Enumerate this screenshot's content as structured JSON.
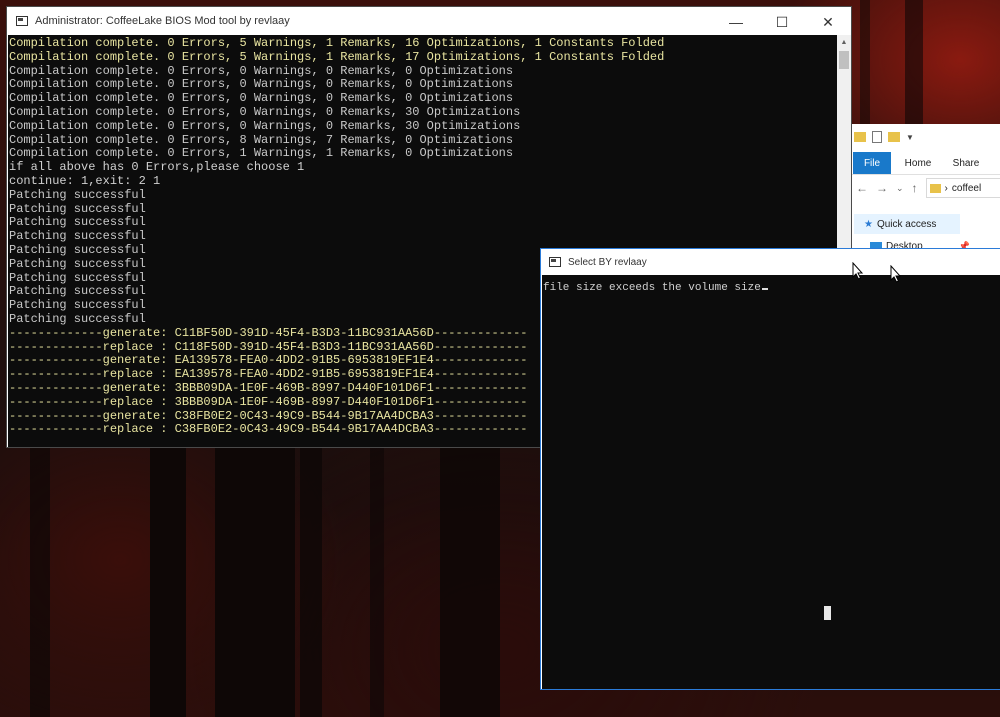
{
  "main_window": {
    "title": "Administrator:  CoffeeLake BIOS Mod tool by revlaay",
    "console_lines": [
      {
        "text": "Compilation complete. 0 Errors, 5 Warnings, 1 Remarks, 16 Optimizations, 1 Constants Folded",
        "tone": "y"
      },
      {
        "text": "Compilation complete. 0 Errors, 5 Warnings, 1 Remarks, 17 Optimizations, 1 Constants Folded",
        "tone": "y"
      },
      {
        "text": "Compilation complete. 0 Errors, 0 Warnings, 0 Remarks, 0 Optimizations",
        "tone": "g"
      },
      {
        "text": "Compilation complete. 0 Errors, 0 Warnings, 0 Remarks, 0 Optimizations",
        "tone": "g"
      },
      {
        "text": "Compilation complete. 0 Errors, 0 Warnings, 0 Remarks, 0 Optimizations",
        "tone": "g"
      },
      {
        "text": "Compilation complete. 0 Errors, 0 Warnings, 0 Remarks, 30 Optimizations",
        "tone": "g"
      },
      {
        "text": "Compilation complete. 0 Errors, 0 Warnings, 0 Remarks, 30 Optimizations",
        "tone": "g"
      },
      {
        "text": "Compilation complete. 0 Errors, 8 Warnings, 7 Remarks, 0 Optimizations",
        "tone": "g"
      },
      {
        "text": "Compilation complete. 0 Errors, 1 Warnings, 1 Remarks, 0 Optimizations",
        "tone": "g"
      },
      {
        "text": "if all above has 0 Errors,please choose 1",
        "tone": "w"
      },
      {
        "text": "continue: 1,exit: 2 1",
        "tone": "w"
      },
      {
        "text": "Patching successful",
        "tone": "g"
      },
      {
        "text": "Patching successful",
        "tone": "g"
      },
      {
        "text": "Patching successful",
        "tone": "g"
      },
      {
        "text": "Patching successful",
        "tone": "g"
      },
      {
        "text": "Patching successful",
        "tone": "g"
      },
      {
        "text": "Patching successful",
        "tone": "g"
      },
      {
        "text": "Patching successful",
        "tone": "g"
      },
      {
        "text": "Patching successful",
        "tone": "g"
      },
      {
        "text": "Patching successful",
        "tone": "g"
      },
      {
        "text": "Patching successful",
        "tone": "g"
      },
      {
        "text": "-------------generate: C11BF50D-391D-45F4-B3D3-11BC931AA56D-------------",
        "tone": "y"
      },
      {
        "text": "-------------replace : C118F50D-391D-45F4-B3D3-11BC931AA56D-------------",
        "tone": "y"
      },
      {
        "text": "-------------generate: EA139578-FEA0-4DD2-91B5-6953819EF1E4-------------",
        "tone": "y"
      },
      {
        "text": "-------------replace : EA139578-FEA0-4DD2-91B5-6953819EF1E4-------------",
        "tone": "y"
      },
      {
        "text": "-------------generate: 3BBB09DA-1E0F-469B-8997-D440F101D6F1-------------",
        "tone": "y"
      },
      {
        "text": "-------------replace : 3BBB09DA-1E0F-469B-8997-D440F101D6F1-------------",
        "tone": "y"
      },
      {
        "text": "-------------generate: C38FB0E2-0C43-49C9-B544-9B17AA4DCBA3-------------",
        "tone": "y"
      },
      {
        "text": "-------------replace : C38FB0E2-0C43-49C9-B544-9B17AA4DCBA3-------------",
        "tone": "y"
      }
    ],
    "controls": {
      "minimize": "—",
      "maximize": "☐",
      "close": "✕"
    }
  },
  "select_window": {
    "title": "Select BY revlaay",
    "console_text": "file size exceeds the volume size"
  },
  "explorer": {
    "tabs": {
      "file": "File",
      "home": "Home",
      "share": "Share"
    },
    "path_segment": "coffeel",
    "nav": {
      "back": "←",
      "forward": "→",
      "recent": "⌄",
      "up": "↑",
      "crumb": "›"
    },
    "quick_access": "Quick access",
    "desktop": "Desktop"
  }
}
